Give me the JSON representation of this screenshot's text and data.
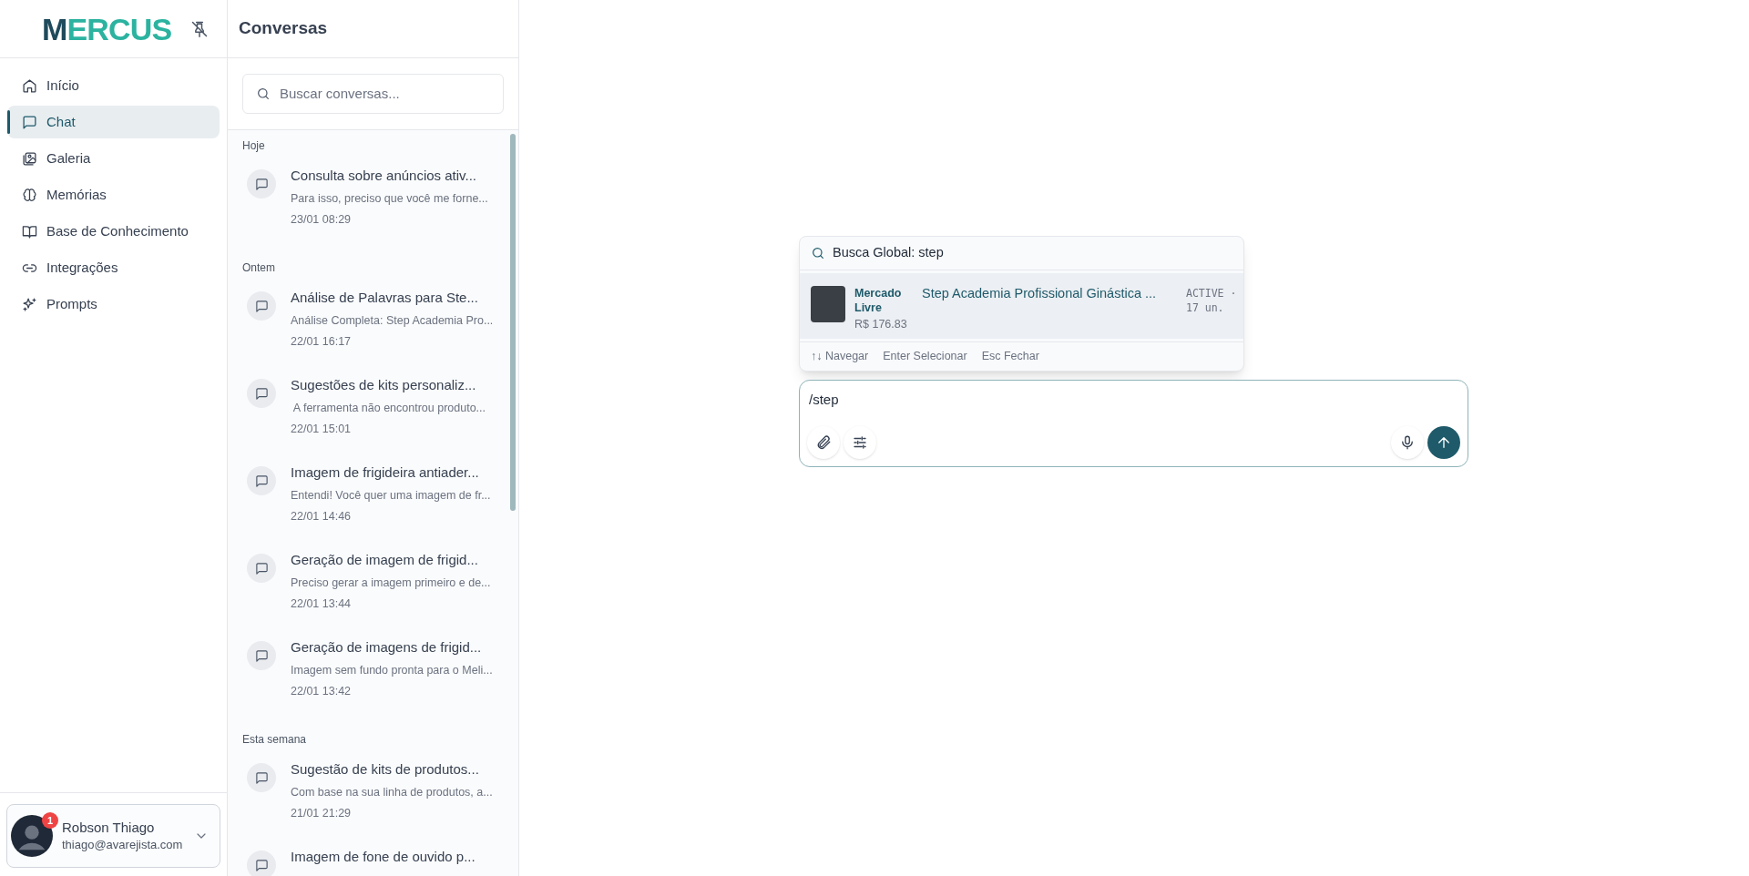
{
  "sidebar": {
    "logo": "MERCUS",
    "items": [
      {
        "label": "Início",
        "selected": false
      },
      {
        "label": "Chat",
        "selected": true
      },
      {
        "label": "Galeria",
        "selected": false
      },
      {
        "label": "Memórias",
        "selected": false
      },
      {
        "label": "Base de Conhecimento",
        "selected": false
      },
      {
        "label": "Integrações",
        "selected": false
      },
      {
        "label": "Prompts",
        "selected": false
      }
    ],
    "user": {
      "name": "Robson Thiago",
      "email": "thiago@avarejista.com",
      "badge": "1"
    }
  },
  "conversations": {
    "title": "Conversas",
    "search_placeholder": "Buscar conversas...",
    "groups": [
      {
        "label": "Hoje",
        "items": [
          {
            "title": "Consulta sobre anúncios ativ...",
            "preview": "Para isso, preciso que você me forne...",
            "time": "23/01 08:29"
          }
        ]
      },
      {
        "label": "Ontem",
        "items": [
          {
            "title": "Análise de Palavras para Ste...",
            "preview": "Análise Completa: Step Academia Pro...",
            "time": "22/01 16:17"
          },
          {
            "title": "Sugestões de kits personaliz...",
            "preview": " A ferramenta não encontrou produto...",
            "time": "22/01 15:01"
          },
          {
            "title": "Imagem de frigideira antiader...",
            "preview": "Entendi! Você quer uma imagem de fr...",
            "time": "22/01 14:46"
          },
          {
            "title": "Geração de imagem de frigid...",
            "preview": "Preciso gerar a imagem primeiro e de...",
            "time": "22/01 13:44"
          },
          {
            "title": "Geração de imagens de frigid...",
            "preview": "Imagem sem fundo pronta para o Meli...",
            "time": "22/01 13:42"
          }
        ]
      },
      {
        "label": "Esta semana",
        "items": [
          {
            "title": "Sugestão de kits de produtos...",
            "preview": "Com base na sua linha de produtos, a...",
            "time": "21/01 21:29"
          },
          {
            "title": "Imagem de fone de ouvido p..."
          }
        ]
      }
    ]
  },
  "search_popup": {
    "header": "Busca Global: step",
    "results": [
      {
        "source": "Mercado Livre",
        "title": "Step Academia Profissional Ginástica ...",
        "price": "R$ 176.83",
        "status": "ACTIVE ·",
        "stock": "17 un.",
        "selected": true
      }
    ],
    "hints": [
      "↑↓ Navegar",
      "Enter Selecionar",
      "Esc Fechar"
    ]
  },
  "composer": {
    "value": "/step"
  }
}
